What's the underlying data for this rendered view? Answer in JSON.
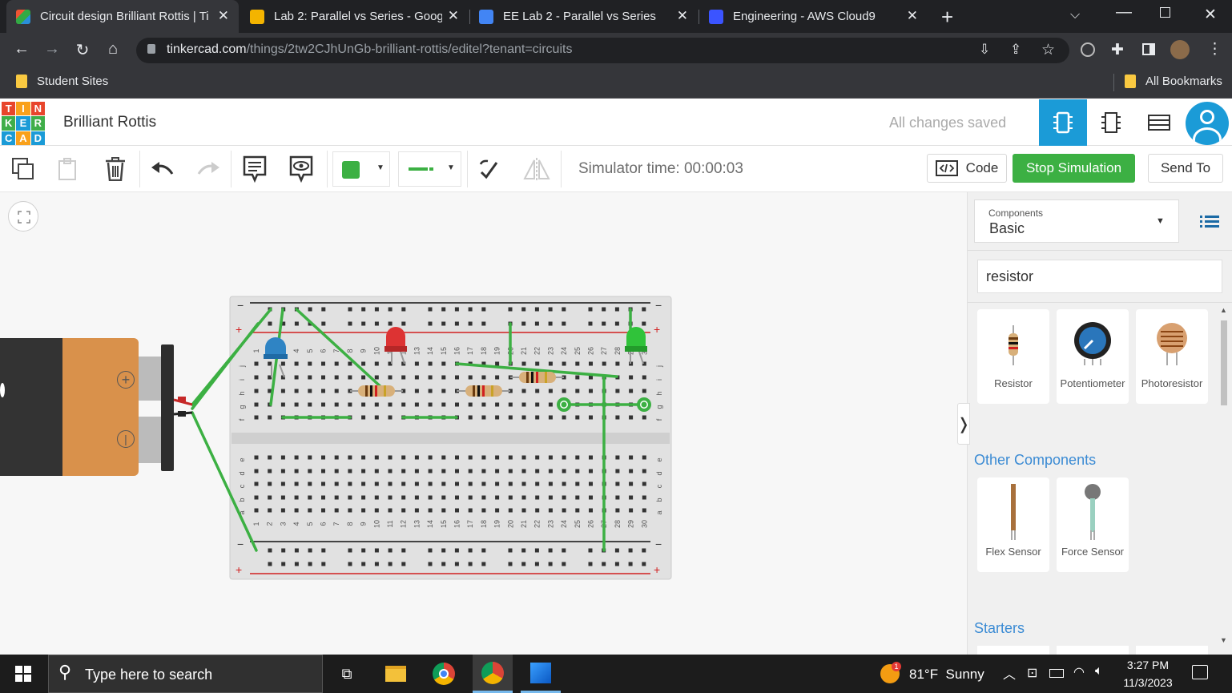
{
  "browser": {
    "tabs": [
      {
        "title": "Circuit design Brilliant Rottis | Tir",
        "active": true
      },
      {
        "title": "Lab 2: Parallel vs Series - Google",
        "active": false
      },
      {
        "title": "EE Lab 2 - Parallel vs Series",
        "active": false
      },
      {
        "title": "Engineering - AWS Cloud9",
        "active": false
      }
    ],
    "url_host": "tinkercad.com",
    "url_path": "/things/2tw2CJhUnGb-brilliant-rottis/editel?tenant=circuits",
    "bookmarks": {
      "left": "Student Sites",
      "right": "All Bookmarks"
    }
  },
  "app": {
    "logo_letters": [
      "T",
      "I",
      "N",
      "K",
      "E",
      "R",
      "C",
      "A",
      "D"
    ],
    "project_title": "Brilliant Rottis",
    "save_status": "All changes saved"
  },
  "toolbar": {
    "sim_time": "Simulator time: 00:00:03",
    "code_label": "Code",
    "stop_label": "Stop Simulation",
    "send_label": "Send To",
    "color_swatch": "#3cb043"
  },
  "panel": {
    "components_caption": "Components",
    "components_value": "Basic",
    "search_value": "resistor",
    "basic_items": [
      "Resistor",
      "Potentiometer",
      "Photoresistor"
    ],
    "other_header": "Other Components",
    "other_items": [
      "Flex Sensor",
      "Force Sensor"
    ],
    "starters_header": "Starters"
  },
  "battery": {
    "plus": "+",
    "minus": "|"
  },
  "breadboard": {
    "rail_sign_minus": "−",
    "rail_sign_plus": "+",
    "column_count": 30,
    "top_rows": [
      "j",
      "i",
      "h",
      "g",
      "f"
    ],
    "bottom_rows": [
      "e",
      "d",
      "c",
      "b",
      "a"
    ]
  },
  "taskbar": {
    "search_placeholder": "Type here to search",
    "weather": "81°F  Sunny",
    "badge": "1",
    "time": "3:27 PM",
    "date": "11/3/2023"
  }
}
